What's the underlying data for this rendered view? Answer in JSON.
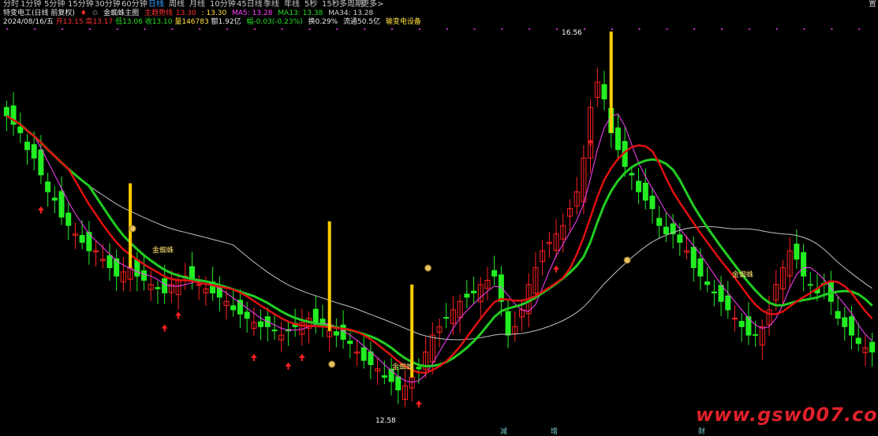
{
  "toolbar": {
    "tabs": [
      {
        "label": "分时",
        "active": false
      },
      {
        "label": "1分钟",
        "active": false
      },
      {
        "label": "5分钟",
        "active": false
      },
      {
        "label": "15分钟",
        "active": false
      },
      {
        "label": "30分钟",
        "active": false
      },
      {
        "label": "60分钟",
        "active": false
      },
      {
        "label": "日线",
        "active": true
      },
      {
        "label": "周线",
        "active": false
      },
      {
        "label": "月线",
        "active": false
      },
      {
        "label": "10分钟",
        "active": false
      },
      {
        "label": "45日线",
        "active": false
      },
      {
        "label": "季线",
        "active": false
      },
      {
        "label": "年线",
        "active": false
      },
      {
        "label": "5秒",
        "active": false
      },
      {
        "label": "15秒",
        "active": false
      },
      {
        "label": "多周期",
        "active": false
      },
      {
        "label": "更多",
        "active": false
      }
    ],
    "more_arrow": ">",
    "right_tab": "置"
  },
  "header": {
    "stock_title": "特变电工(日线 前复权)",
    "indicator_name": "金蜘蛛主图",
    "main_label": "主趋势线",
    "main_value": "13.30",
    "val2": ": 13.30",
    "ma5": "MA5: 13.28",
    "ma13": "MA13: 13.38",
    "ma34": "MA34: 13.28",
    "date": "2024/08/16/五",
    "open": "开13.15",
    "high": "高13.17",
    "low": "低13.06",
    "close": "收13.10",
    "volume": "量146783",
    "amount": "额1.92亿",
    "change": "幅-0.03(-0.23%)",
    "turnover": "换0.29%",
    "float_cap": "流通50.5亿",
    "sector": "输变电设备"
  },
  "colors": {
    "up": "#ff2020",
    "down": "#22ee22",
    "ma_main": "#e01010",
    "ma5": "#ff40ff",
    "ma13": "#22cc22",
    "ma34": "#c0c0c0",
    "signal_yellow": "#ffcc00",
    "bg": "#000000"
  },
  "annotations": {
    "high_price": "16.56",
    "low_price": "12.58",
    "spider_label": "金蜘蛛",
    "event_tags": [
      "减",
      "增",
      "财"
    ]
  },
  "watermark": "www.gsw007.com",
  "chart_data": {
    "type": "candlestick",
    "price_range": [
      12.3,
      16.9
    ],
    "close_series": [
      15.9,
      15.8,
      15.7,
      15.5,
      15.4,
      15.2,
      15.0,
      14.9,
      14.7,
      14.6,
      14.5,
      14.4,
      14.3,
      14.3,
      14.2,
      14.1,
      14.0,
      14.05,
      14.1,
      14.0,
      13.95,
      13.9,
      13.85,
      13.8,
      13.9,
      13.95,
      14.0,
      13.95,
      13.9,
      13.85,
      13.8,
      13.75,
      13.7,
      13.6,
      13.55,
      13.5,
      13.45,
      13.4,
      13.4,
      13.35,
      13.3,
      13.35,
      13.4,
      13.45,
      13.5,
      13.45,
      13.4,
      13.35,
      13.3,
      13.25,
      13.2,
      13.1,
      13.0,
      12.95,
      12.9,
      12.8,
      12.75,
      12.65,
      12.7,
      12.8,
      12.9,
      13.1,
      13.3,
      13.4,
      13.5,
      13.6,
      13.7,
      13.75,
      13.8,
      13.9,
      13.95,
      14.0,
      13.7,
      13.3,
      13.4,
      13.6,
      13.9,
      14.1,
      14.3,
      14.4,
      14.5,
      14.6,
      14.8,
      15.0,
      15.4,
      16.0,
      16.3,
      16.1,
      15.7,
      15.5,
      15.3,
      15.2,
      15.0,
      14.9,
      14.8,
      14.6,
      14.5,
      14.5,
      14.4,
      14.3,
      14.1,
      14.0,
      13.9,
      13.8,
      13.7,
      13.6,
      13.5,
      13.4,
      13.3,
      13.3,
      13.4,
      13.6,
      13.9,
      14.1,
      14.3,
      14.2,
      14.0,
      13.9,
      13.8,
      13.9,
      13.7,
      13.5,
      13.4,
      13.3,
      13.2,
      13.15,
      13.1
    ]
  }
}
